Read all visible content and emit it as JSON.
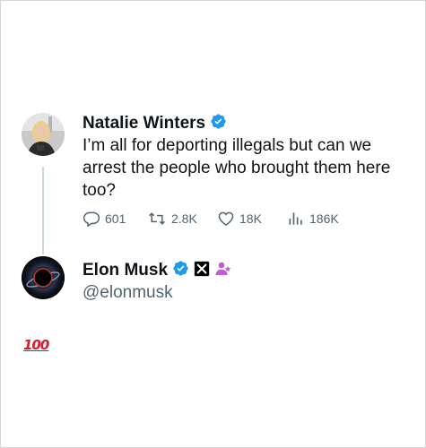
{
  "original_tweet": {
    "author_name": "Natalie Winters",
    "verified": true,
    "text": "I’m all for deporting illegals but can we arrest the people who brought them here too?",
    "stats": {
      "replies": "601",
      "reposts": "2.8K",
      "likes": "18K",
      "views": "186K"
    }
  },
  "reply_author": {
    "name": "Elon Musk",
    "handle": "@elonmusk",
    "verified": true,
    "affiliate_badge": "x-logo-badge",
    "extra_badge": "government-person-icon"
  },
  "reaction": {
    "emoji_name": "hundred-points-emoji",
    "text": "100"
  },
  "colors": {
    "verified_blue": "#1d9bf0",
    "secondary_text": "#536471",
    "thread_line": "#cfd9de",
    "hundred_red": "#d81b2c",
    "badge_purple": "#c05bd3"
  }
}
